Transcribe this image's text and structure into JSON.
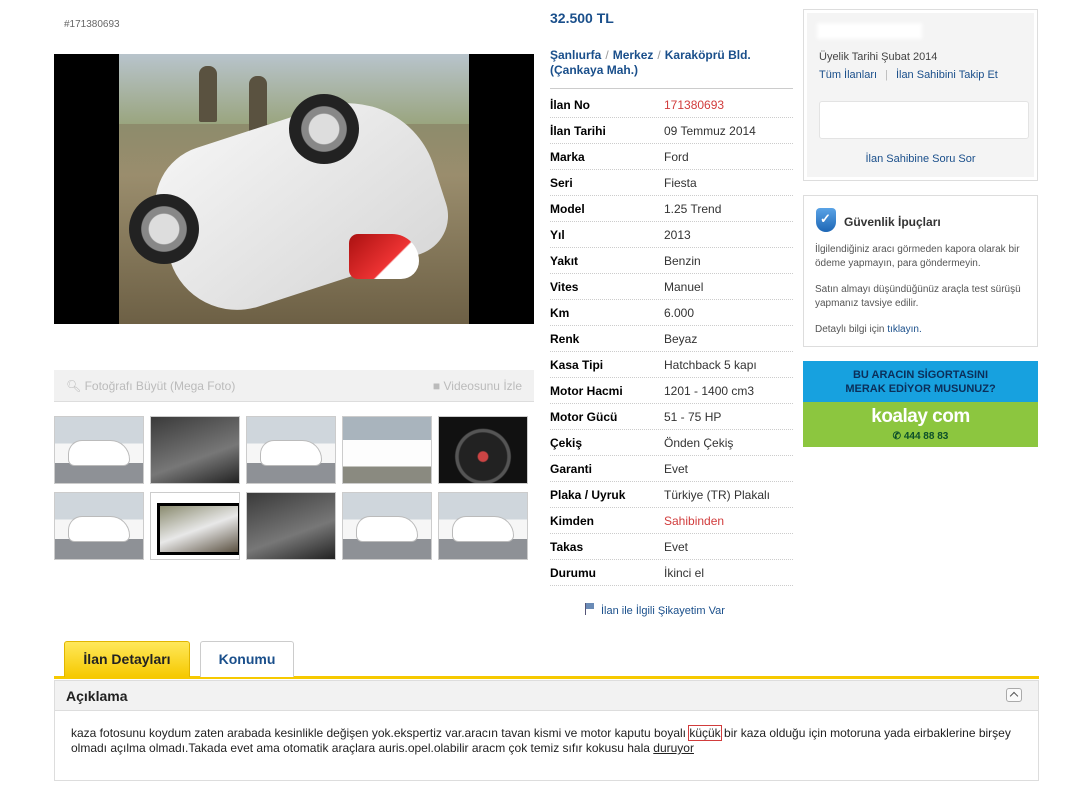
{
  "listing_id": "#171380693",
  "price": "32.500 TL",
  "location": {
    "city": "Şanlıurfa",
    "district": "Merkez",
    "neighborhood": "Karaköprü Bld. (Çankaya Mah.)"
  },
  "photo_toolbar": {
    "enlarge": "Fotoğrafı Büyüt (Mega Foto)",
    "video": "Videosunu İzle"
  },
  "specs": [
    {
      "label": "İlan No",
      "value": "171380693",
      "color": "#d13c3c"
    },
    {
      "label": "İlan Tarihi",
      "value": "09 Temmuz 2014"
    },
    {
      "label": "Marka",
      "value": "Ford"
    },
    {
      "label": "Seri",
      "value": "Fiesta"
    },
    {
      "label": "Model",
      "value": "1.25 Trend"
    },
    {
      "label": "Yıl",
      "value": "2013"
    },
    {
      "label": "Yakıt",
      "value": "Benzin"
    },
    {
      "label": "Vites",
      "value": "Manuel"
    },
    {
      "label": "Km",
      "value": "6.000"
    },
    {
      "label": "Renk",
      "value": "Beyaz"
    },
    {
      "label": "Kasa Tipi",
      "value": "Hatchback 5 kapı"
    },
    {
      "label": "Motor Hacmi",
      "value": "1201 - 1400 cm3"
    },
    {
      "label": "Motor Gücü",
      "value": "51 - 75 HP"
    },
    {
      "label": "Çekiş",
      "value": "Önden Çekiş"
    },
    {
      "label": "Garanti",
      "value": "Evet"
    },
    {
      "label": "Plaka / Uyruk",
      "value": "Türkiye (TR) Plakalı"
    },
    {
      "label": "Kimden",
      "value": "Sahibinden",
      "color": "#d13c3c"
    },
    {
      "label": "Takas",
      "value": "Evet"
    },
    {
      "label": "Durumu",
      "value": "İkinci el"
    }
  ],
  "complaint_link": "İlan ile İlgili Şikayetim Var",
  "seller": {
    "member_since": "Üyelik Tarihi  Şubat 2014",
    "all_listings": "Tüm İlanları",
    "follow": "İlan Sahibini Takip Et",
    "ask": "İlan Sahibine Soru Sor"
  },
  "safety": {
    "title": "Güvenlik İpuçları",
    "p1": "İlgilendiğiniz aracı görmeden kapora olarak bir ödeme yapmayın, para göndermeyin.",
    "p2": "Satın almayı düşündüğünüz araçla test sürüşü yapmanız tavsiye edilir.",
    "p3_prefix": "Detaylı bilgi için ",
    "p3_link": "tıklayın."
  },
  "ad": {
    "line1": "BU ARACIN SİGORTASINI",
    "line2": "MERAK EDİYOR MUSUNUZ?",
    "brand": "koalay com",
    "phone": "✆ 444 88 83"
  },
  "tabs": {
    "details": "İlan Detayları",
    "location": "Konumu"
  },
  "description": {
    "title": "Açıklama",
    "text_1": "kaza fotosunu koydum zaten arabada kesinlikle değişen yok.ekspertiz var.aracın tavan kismi ve motor kaputu boyalı ",
    "text_boxed": "küçük",
    "text_2": " bir kaza olduğu için motoruna yada eirbaklerine birşey olmadı açılma olmadı.Takada evet ama otomatik araçlara auris.opel.olabilir aracm çok temiz sıfır kokusu hala ",
    "text_underlined": "duruyor"
  },
  "colors": {
    "link_blue": "#1a4f8b",
    "highlight_red": "#d13c3c",
    "tab_yellow": "#f6c900",
    "ad_blue": "#17a1df",
    "ad_green": "#8cc63f"
  }
}
